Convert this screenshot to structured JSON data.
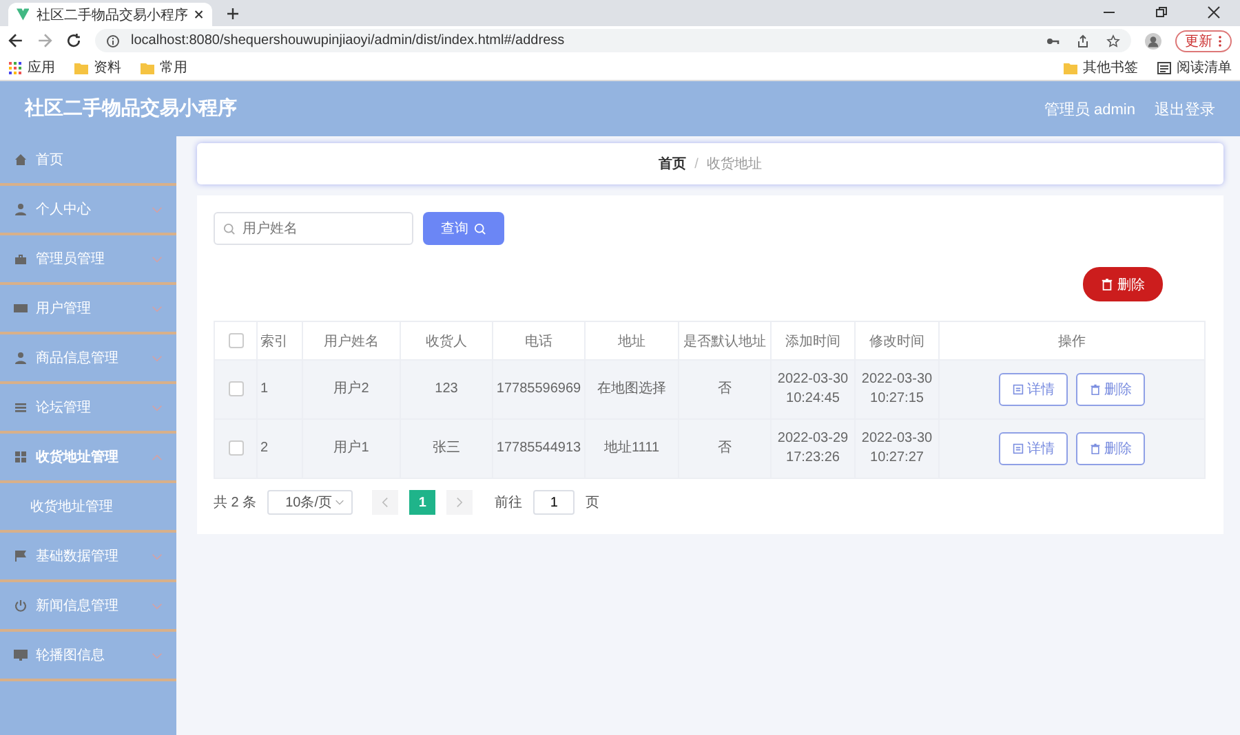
{
  "browser": {
    "tab_title": "社区二手物品交易小程序",
    "url": "localhost:8080/shequershouwupinjiaoyi/admin/dist/index.html#/address",
    "update_button": "更新",
    "bookmarks": [
      "应用",
      "资料",
      "常用"
    ],
    "bookmarks_right": [
      "其他书签",
      "阅读清单"
    ]
  },
  "header": {
    "title": "社区二手物品交易小程序",
    "user": "管理员 admin",
    "logout": "退出登录"
  },
  "sidebar": {
    "items": [
      {
        "label": "首页"
      },
      {
        "label": "个人中心",
        "expanded": false
      },
      {
        "label": "管理员管理",
        "expanded": false
      },
      {
        "label": "用户管理",
        "expanded": false
      },
      {
        "label": "商品信息管理",
        "expanded": false
      },
      {
        "label": "论坛管理",
        "expanded": false
      },
      {
        "label": "收货地址管理",
        "expanded": true,
        "children": [
          {
            "label": "收货地址管理"
          }
        ]
      },
      {
        "label": "基础数据管理",
        "expanded": false
      },
      {
        "label": "新闻信息管理",
        "expanded": false
      },
      {
        "label": "轮播图信息",
        "expanded": false
      }
    ]
  },
  "breadcrumb": {
    "items": [
      "首页",
      "收货地址"
    ],
    "separator": "/"
  },
  "search": {
    "placeholder": "用户姓名",
    "button": "查询"
  },
  "delete_button": "删除",
  "table": {
    "all_checked": false,
    "columns": [
      "索引",
      "用户姓名",
      "收货人",
      "电话",
      "地址",
      "是否默认地址",
      "添加时间",
      "修改时间",
      "操作"
    ],
    "rows": [
      {
        "checked": false,
        "cells": [
          "1",
          "用户2",
          "123",
          "17785596969",
          "在地图选择",
          "否",
          "2022-03-30 10:24:45",
          "2022-03-30 10:27:15"
        ],
        "actions": [
          "详情",
          "删除"
        ]
      },
      {
        "checked": false,
        "cells": [
          "2",
          "用户1",
          "张三",
          "17785544913",
          "地址1111",
          "否",
          "2022-03-29 17:23:26",
          "2022-03-30 10:27:27"
        ],
        "actions": [
          "详情",
          "删除"
        ]
      }
    ]
  },
  "pagination": {
    "total": "共 2 条",
    "page_size": "10条/页",
    "pages": [
      {
        "label": "1",
        "selected": true
      }
    ],
    "goto_label": "前往",
    "goto_value": "1",
    "goto_suffix": "页"
  }
}
